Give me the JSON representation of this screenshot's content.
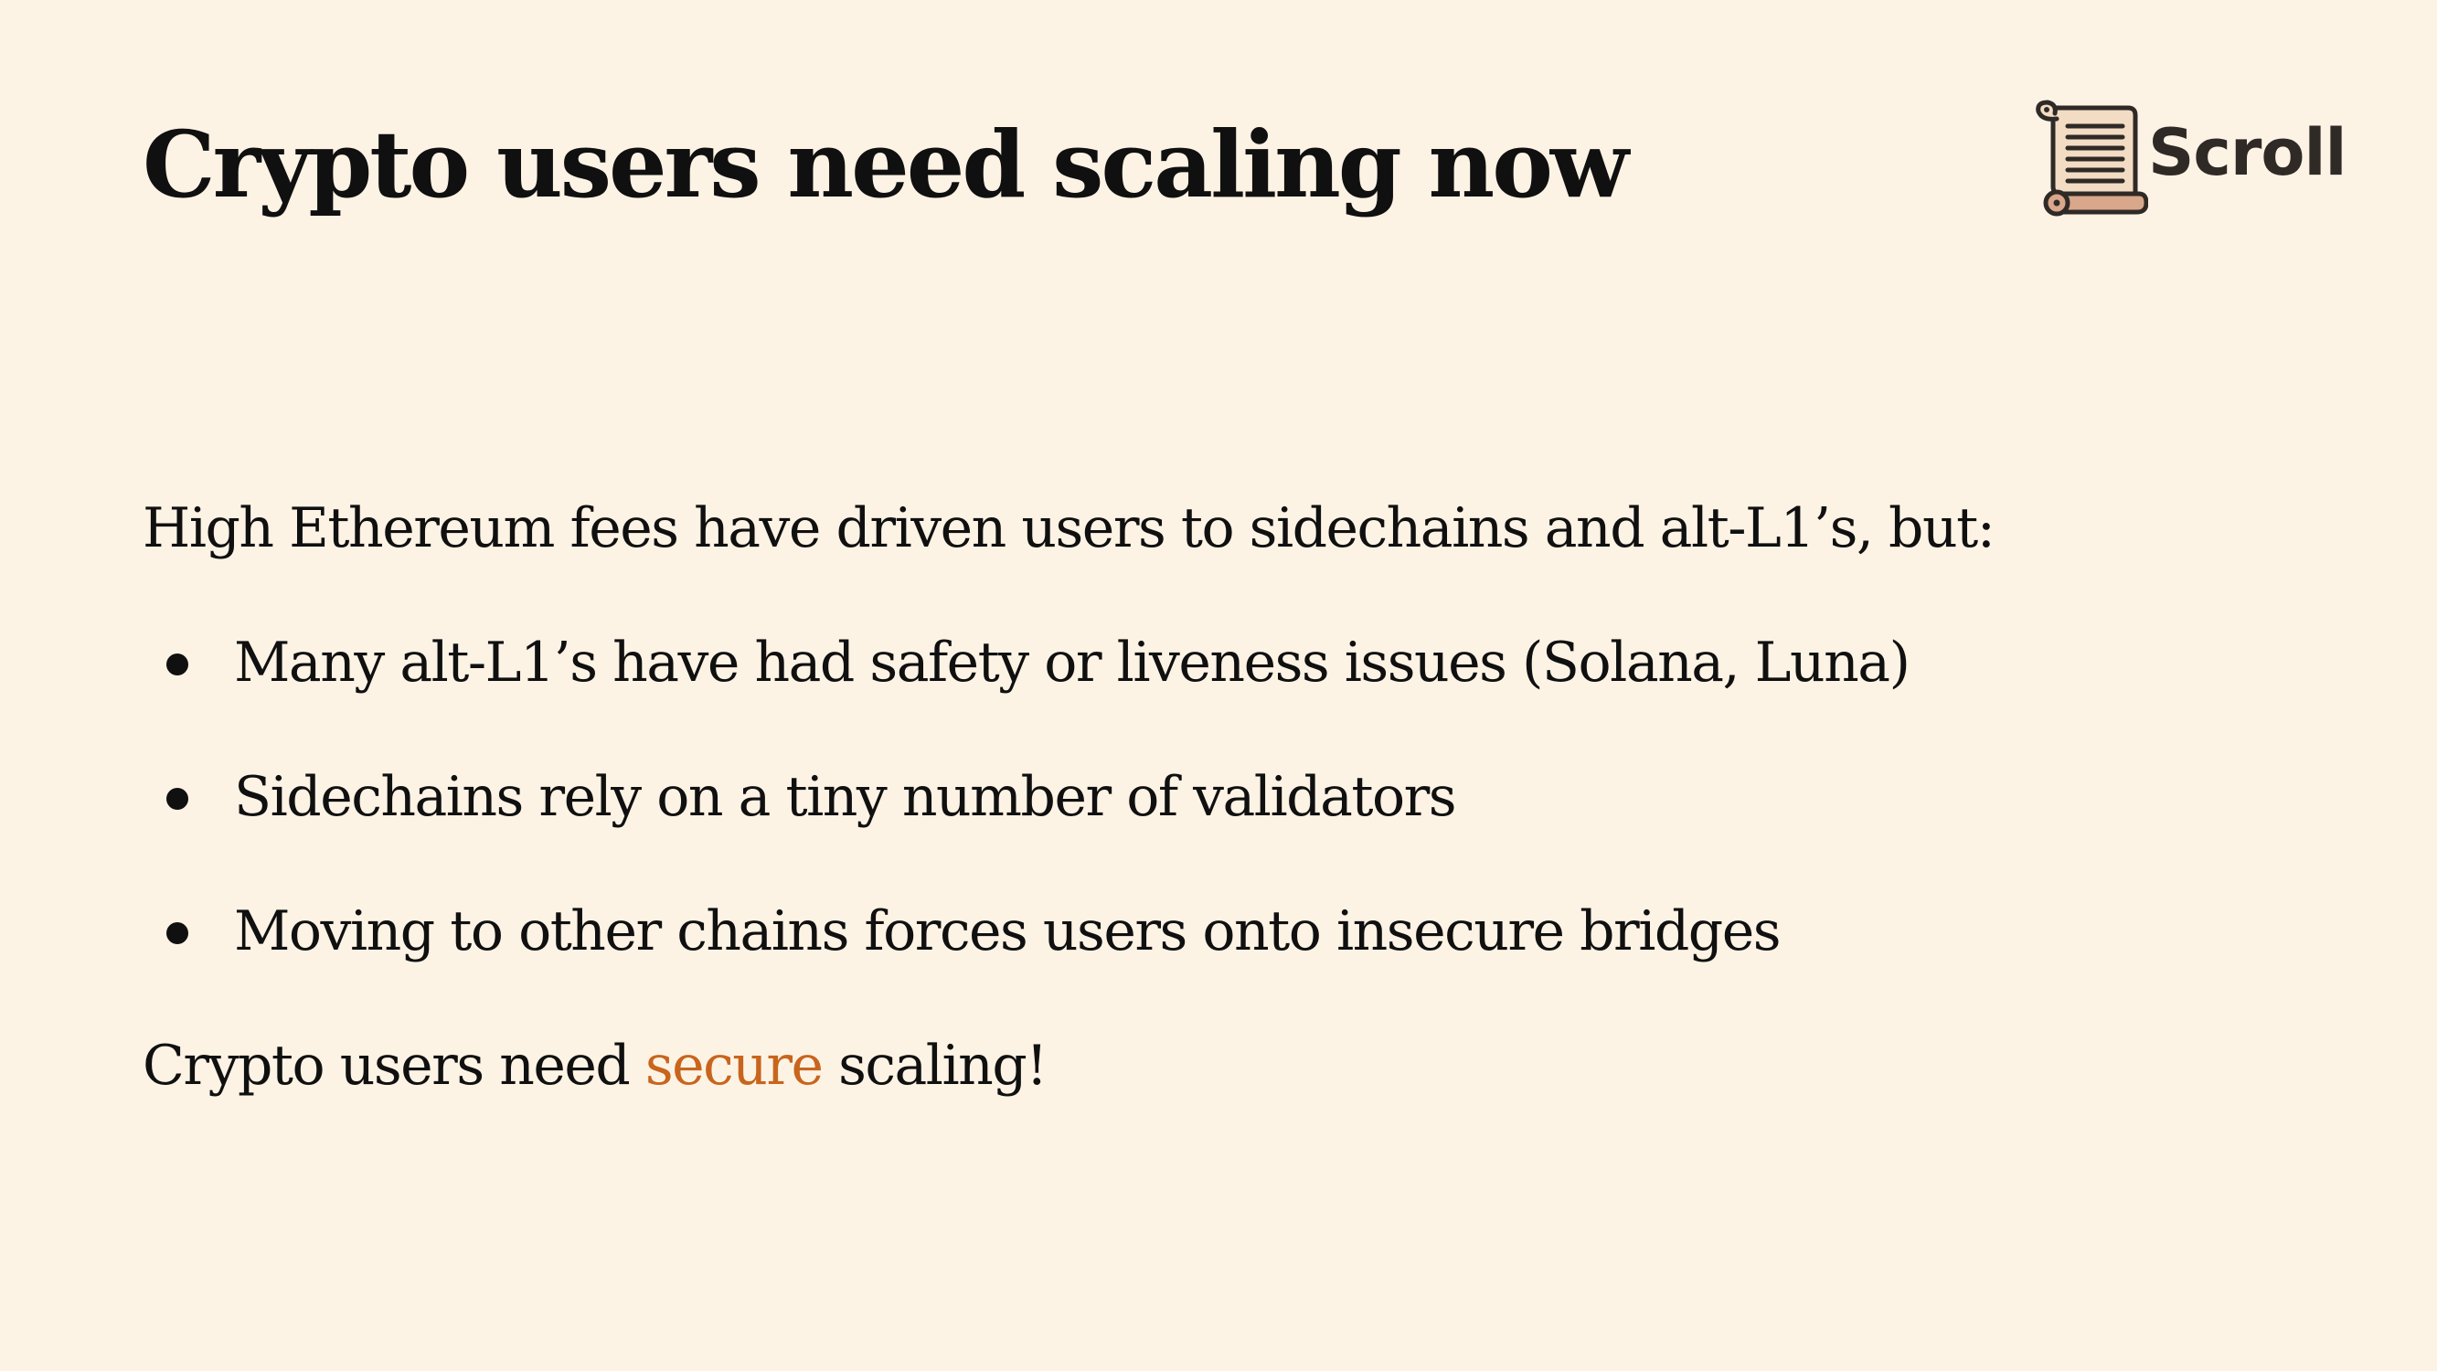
{
  "slide": {
    "title": "Crypto users need scaling now",
    "logo": {
      "text": "Scroll",
      "icon": "scroll-icon"
    },
    "intro": "High Ethereum fees have driven users to sidechains and alt-L1’s, but:",
    "bullets": [
      "Many alt-L1’s have had safety or liveness issues (Solana, Luna)",
      "Sidechains rely on a tiny number of validators",
      "Moving to other chains forces users onto insecure bridges"
    ],
    "conclusion": {
      "before": "Crypto users need ",
      "highlight": "secure",
      "after": " scaling!"
    }
  },
  "colors": {
    "background": "#fdf3e5",
    "text": "#101010",
    "accent": "#c8651d",
    "logo_text": "#2f2a26",
    "scroll_paper": "#f3dcc4",
    "scroll_roll": "#d9a78c"
  }
}
